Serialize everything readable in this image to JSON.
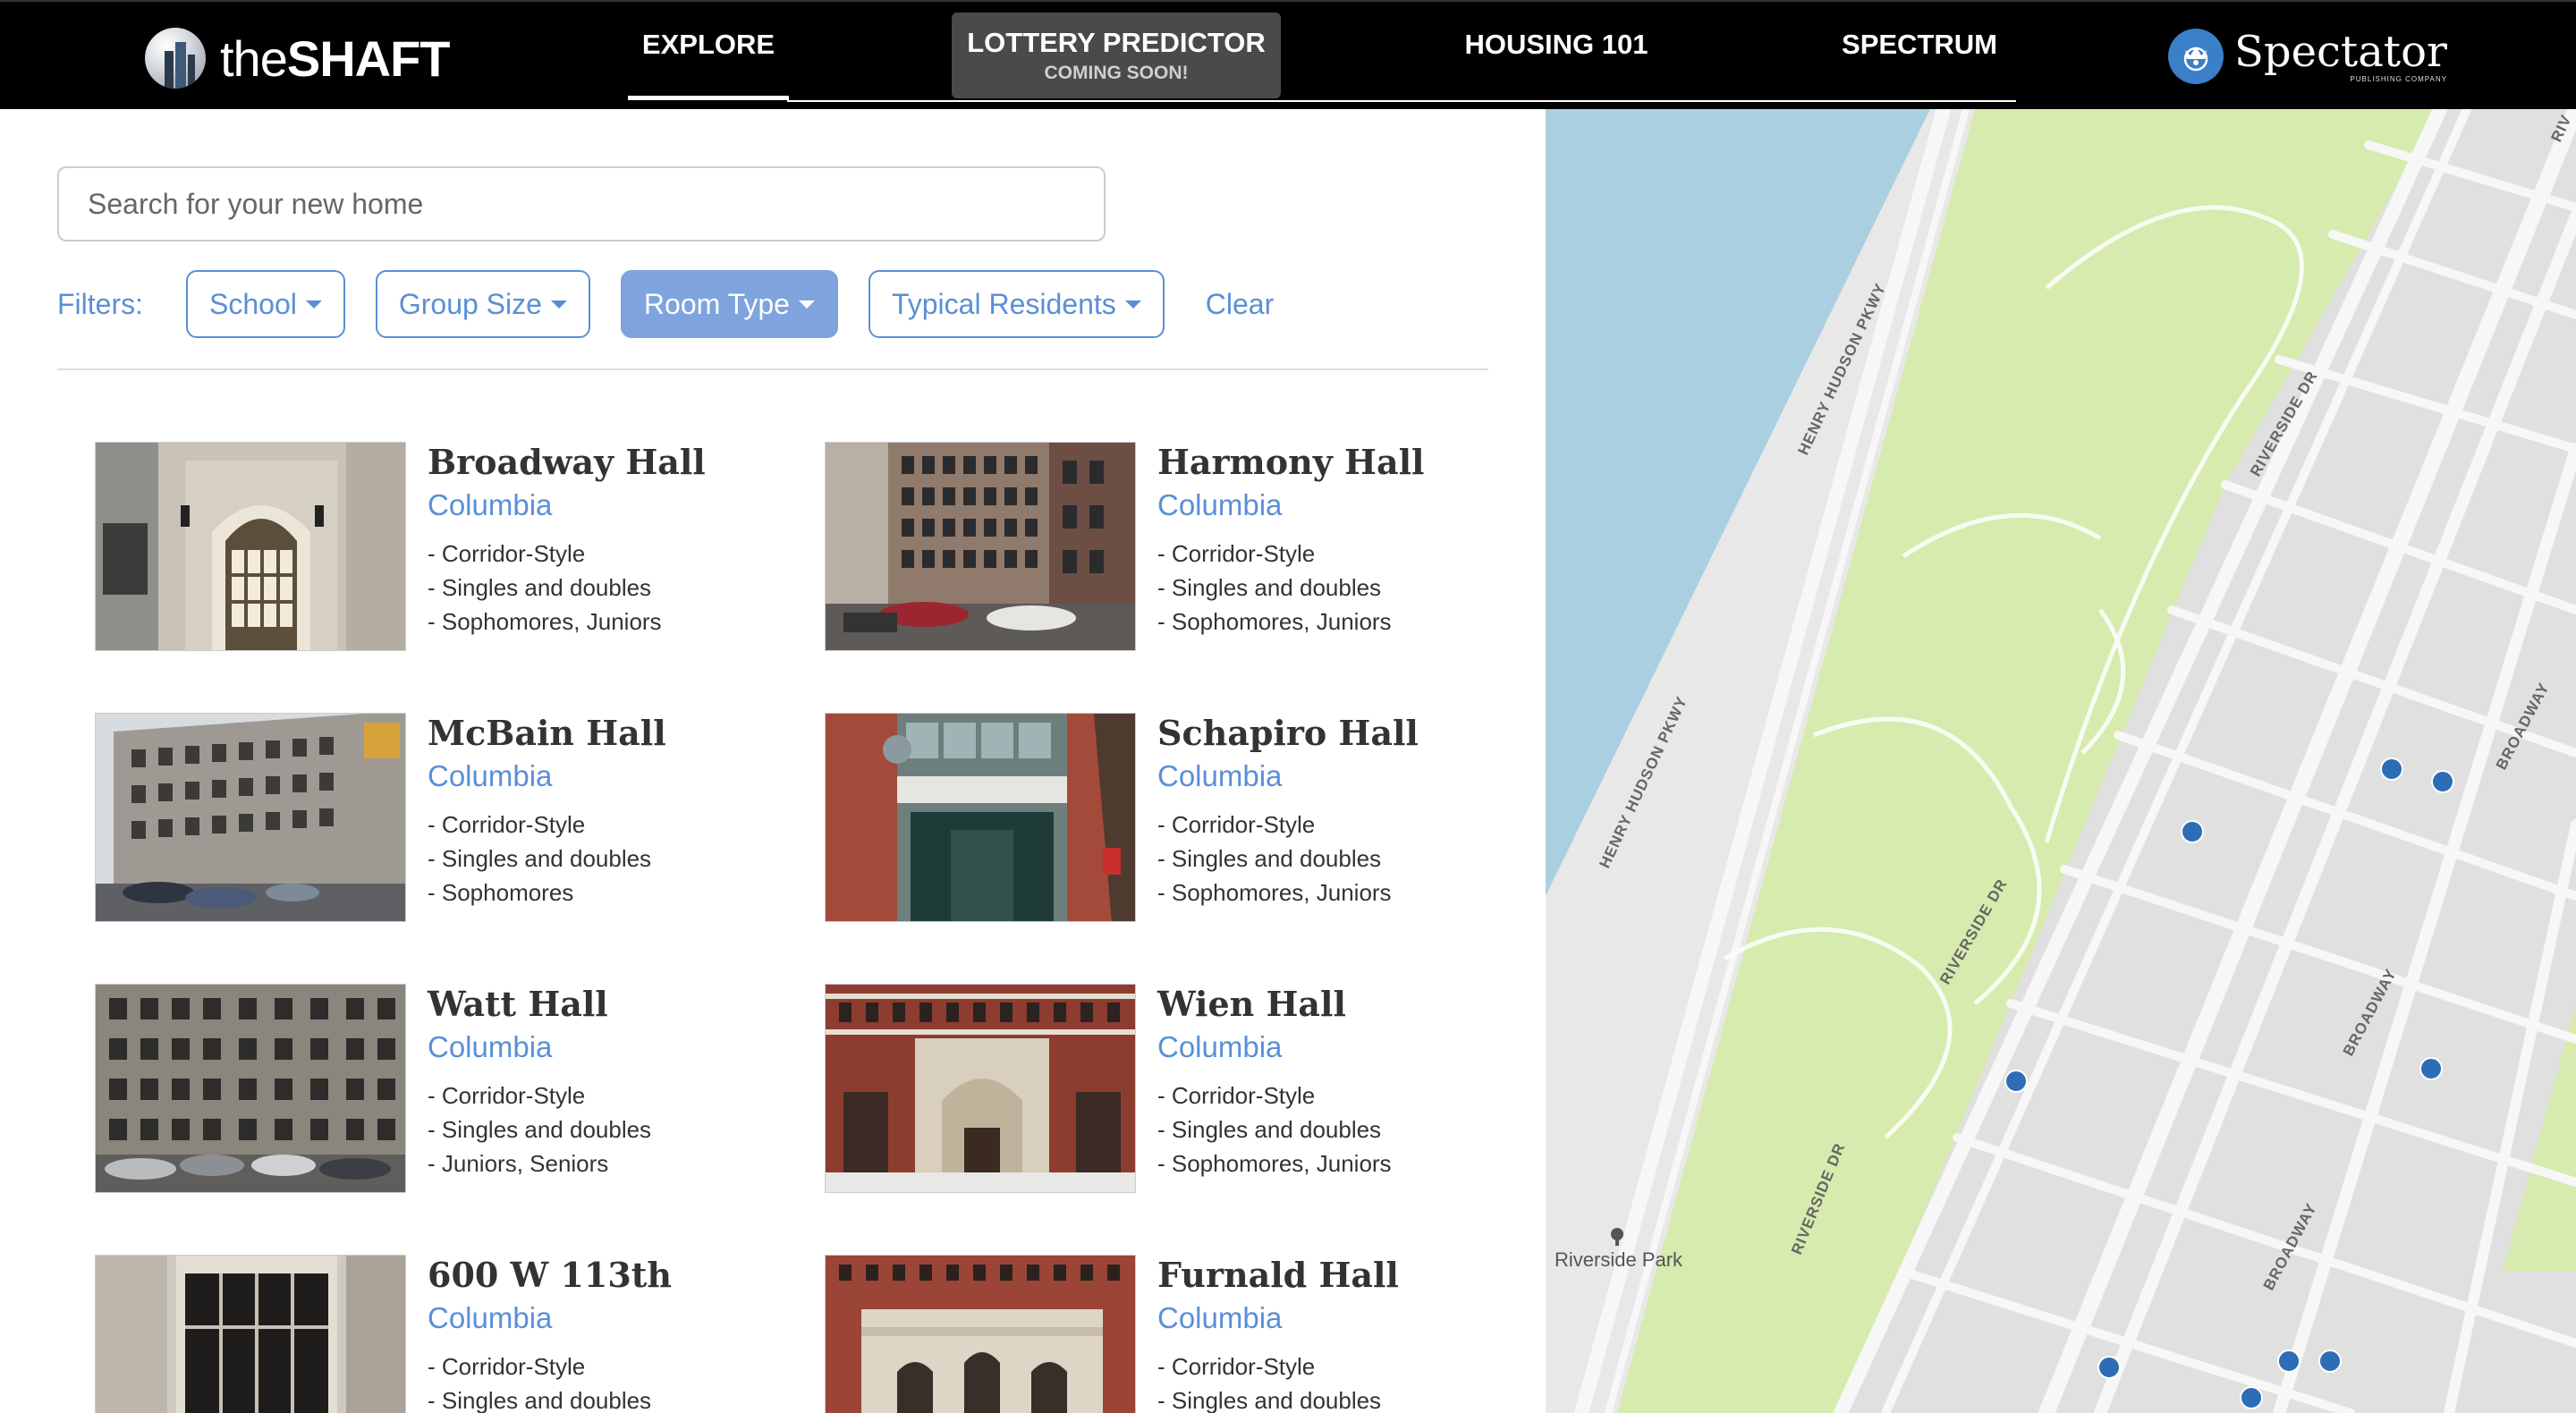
{
  "nav": {
    "logo_thin": "the",
    "logo_bold": "SHAFT",
    "items": [
      {
        "label": "EXPLORE"
      },
      {
        "label": "LOTTERY PREDICTOR",
        "sub": "COMING SOON!"
      },
      {
        "label": "HOUSING 101"
      },
      {
        "label": "SPECTRUM"
      }
    ],
    "partner": "Spectator",
    "partner_sub": "PUBLISHING COMPANY"
  },
  "search": {
    "placeholder": "Search for your new home"
  },
  "filters": {
    "label": "Filters:",
    "buttons": [
      "School",
      "Group Size",
      "Room Type",
      "Typical Residents"
    ],
    "active": "Room Type",
    "clear": "Clear"
  },
  "halls": [
    {
      "name": "Broadway Hall",
      "school": "Columbia",
      "features": [
        "- Corridor-Style",
        "- Singles and doubles",
        "- Sophomores, Juniors"
      ]
    },
    {
      "name": "Harmony Hall",
      "school": "Columbia",
      "features": [
        "- Corridor-Style",
        "- Singles and doubles",
        "- Sophomores, Juniors"
      ]
    },
    {
      "name": "McBain Hall",
      "school": "Columbia",
      "features": [
        "- Corridor-Style",
        "- Singles and doubles",
        "- Sophomores"
      ]
    },
    {
      "name": "Schapiro Hall",
      "school": "Columbia",
      "features": [
        "- Corridor-Style",
        "- Singles and doubles",
        "- Sophomores, Juniors"
      ]
    },
    {
      "name": "Watt Hall",
      "school": "Columbia",
      "features": [
        "- Corridor-Style",
        "- Singles and doubles",
        "- Juniors, Seniors"
      ]
    },
    {
      "name": "Wien Hall",
      "school": "Columbia",
      "features": [
        "- Corridor-Style",
        "- Singles and doubles",
        "- Sophomores, Juniors"
      ]
    },
    {
      "name": "600 W 113th",
      "school": "Columbia",
      "features": [
        "- Corridor-Style",
        "- Singles and doubles"
      ]
    },
    {
      "name": "Furnald Hall",
      "school": "Columbia",
      "features": [
        "- Corridor-Style",
        "- Singles and doubles"
      ]
    }
  ],
  "map": {
    "labels": {
      "hhp1": "HENRY HUDSON PKWY",
      "hhp2": "HENRY HUDSON PKWY",
      "rsd1": "RIVERSIDE DR",
      "rsd2": "RIVERSIDE DR",
      "rsd3": "RIVERSIDE DR",
      "bway1": "BROADWAY",
      "bway2": "BROADWAY",
      "bway3": "BROADWAY",
      "riv": "RIV",
      "park": "Riverside Park"
    },
    "colors": {
      "water": "#aacfe0",
      "park": "#d6ebad",
      "road": "#f7f7f7",
      "block": "#e0e0e0",
      "marker": "#2d6db5"
    }
  }
}
